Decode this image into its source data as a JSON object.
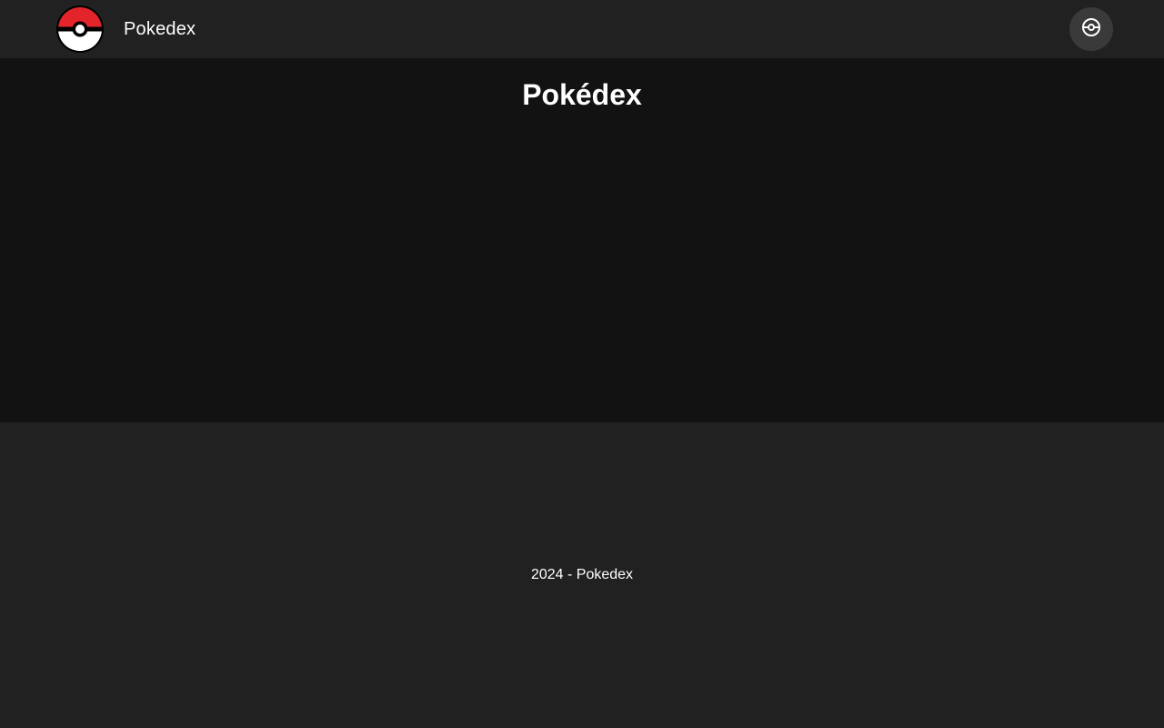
{
  "header": {
    "app_title": "Pokedex",
    "logo_icon": "pokeball-logo-icon",
    "theme_toggle_icon": "pokeball-outline-icon"
  },
  "main": {
    "page_title": "Pokédex"
  },
  "footer": {
    "text": "2024 - Pokedex"
  },
  "colors": {
    "header_bg": "#212121",
    "main_bg": "#121212",
    "footer_bg": "#212121",
    "pokeball_red": "#e3242b",
    "text": "#ffffff"
  }
}
